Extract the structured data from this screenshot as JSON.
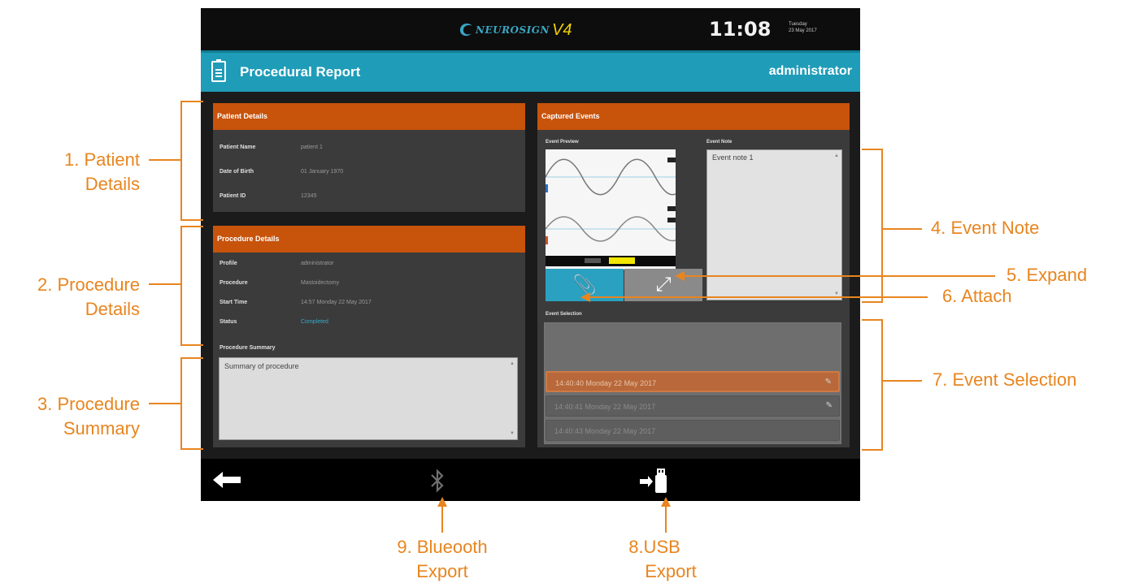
{
  "device": {
    "logo_brand": "NEUROSIGN",
    "logo_version": "V4",
    "time": "11:08",
    "day": "Tuesday",
    "date": "23 May 2017"
  },
  "header": {
    "title": "Procedural Report",
    "user": "administrator"
  },
  "patient": {
    "heading": "Patient Details",
    "rows": [
      {
        "label": "Patient Name",
        "value": "patient 1"
      },
      {
        "label": "Date of Birth",
        "value": "01 January 1970"
      },
      {
        "label": "Patient ID",
        "value": "12345"
      }
    ]
  },
  "procedure": {
    "heading": "Procedure Details",
    "rows": [
      {
        "label": "Profile",
        "value": "administrator"
      },
      {
        "label": "Procedure",
        "value": "Mastoidectomy"
      },
      {
        "label": "Start Time",
        "value": "14:57 Monday 22 May 2017"
      },
      {
        "label": "Status",
        "value": "Completed"
      }
    ],
    "summary_label": "Procedure Summary",
    "summary_text": "Summary of procedure"
  },
  "events": {
    "heading": "Captured Events",
    "preview_label": "Event Preview",
    "note_label": "Event Note",
    "note_text": "Event note 1",
    "selection_label": "Event Selection",
    "items": [
      {
        "text": "14:40:40 Monday 22 May 2017",
        "selected": true
      },
      {
        "text": "14:40:41 Monday 22 May 2017",
        "selected": false
      },
      {
        "text": "14:40:43 Monday 22 May 2017",
        "selected": false
      }
    ],
    "attach_icon": "paperclip-icon",
    "expand_icon": "expand-icon"
  },
  "footer": {
    "back_icon": "back-arrow-icon",
    "bluetooth_icon": "bluetooth-icon",
    "usb_icon": "usb-export-icon"
  },
  "annotations": {
    "a1": "1. Patient\nDetails",
    "a2": "2. Procedure\nDetails",
    "a3": "3. Procedure\nSummary",
    "a4": "4. Event Note",
    "a5": "5. Expand",
    "a6": "6. Attach",
    "a7": "7. Event Selection",
    "a8": "8.USB\nExport",
    "a9": "9. Blueooth\nExport"
  },
  "colors": {
    "accent_orange": "#e8851f",
    "header_teal": "#1f9cb8",
    "panel_orange": "#c8530b"
  }
}
